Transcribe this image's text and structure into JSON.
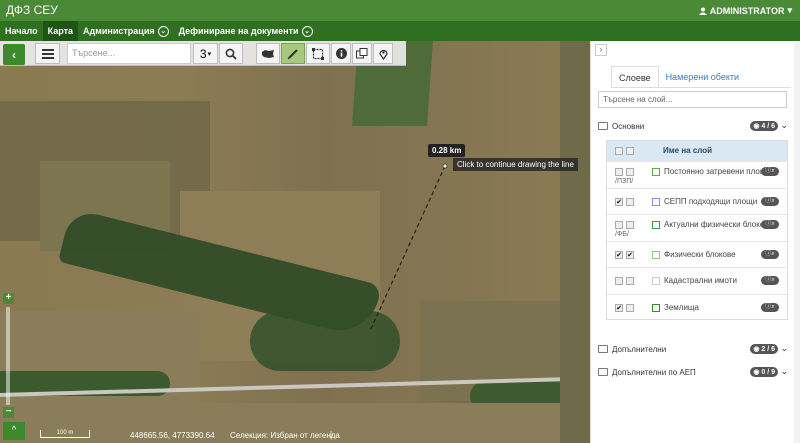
{
  "app": {
    "title": "ДФЗ СЕУ",
    "user": "ADMINISTRATOR"
  },
  "nav": [
    {
      "label": "Начало",
      "caret": false,
      "active": false
    },
    {
      "label": "Карта",
      "caret": false,
      "active": true
    },
    {
      "label": "Администрация",
      "caret": true,
      "active": false
    },
    {
      "label": "Дефиниране на документи",
      "caret": true,
      "active": false
    }
  ],
  "map": {
    "search_placeholder": "Търсене...",
    "scale_select": "3",
    "measure_label": "0.28 km",
    "continue_tip": "Click to continue drawing the line",
    "scale_bar": "100 m",
    "coordinates": "448665.56, 4773390.64",
    "selection_status": "Селекция: Избран от легенда"
  },
  "panel": {
    "tabs": [
      "Слоеве",
      "Намерени обекти"
    ],
    "layer_search_placeholder": "Търсене на слой...",
    "groups": [
      {
        "name": "Основни",
        "badge": "4 / 6"
      },
      {
        "name": "Допълнителни",
        "badge": "2 / 6"
      },
      {
        "name": "Допълнителни по АЕП",
        "badge": "0 / 9"
      }
    ],
    "layer_header": "Име на слой",
    "layers": [
      {
        "name": "Постоянно затревени площи",
        "sub": "/ПЗП/",
        "checked1": false,
        "checked2": false,
        "swatch": "#5aaa3a"
      },
      {
        "name": "СЕПП подходящи площи",
        "sub": "",
        "checked1": true,
        "checked2": false,
        "swatch": "#8a8ad8"
      },
      {
        "name": "Актуални физически блокове",
        "sub": "/ФБ/",
        "checked1": false,
        "checked2": false,
        "swatch": "#3a9a3a"
      },
      {
        "name": "Физически блокове",
        "sub": "",
        "checked1": true,
        "checked2": true,
        "swatch": "#8ad07a"
      },
      {
        "name": "Кадастрални имоти",
        "sub": "",
        "checked1": false,
        "checked2": false,
        "swatch": "#cccccc"
      },
      {
        "name": "Землища",
        "sub": "",
        "checked1": true,
        "checked2": false,
        "swatch": "#3a8a2a"
      }
    ]
  }
}
